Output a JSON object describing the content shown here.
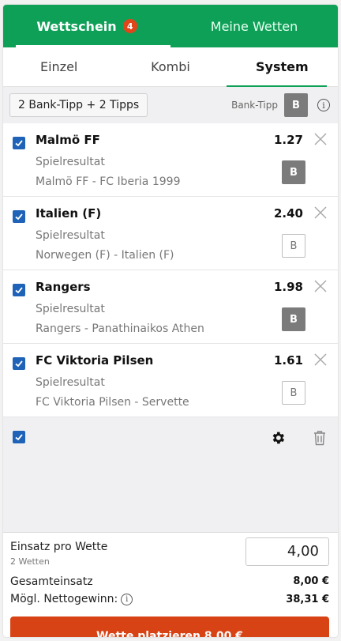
{
  "header": {
    "tabs": [
      {
        "label": "Wettschein",
        "badge": "4",
        "active": true
      },
      {
        "label": "Meine Wetten",
        "active": false
      }
    ]
  },
  "subtabs": [
    {
      "label": "Einzel",
      "active": false
    },
    {
      "label": "Kombi",
      "active": false
    },
    {
      "label": "System",
      "active": true
    }
  ],
  "system": {
    "selected": "2 Bank-Tipp + 2 Tipps",
    "bank_label": "Bank-Tipp",
    "bank_button": "B",
    "info_icon": "info-icon"
  },
  "bets": [
    {
      "name": "Malmö FF",
      "odds": "1.27",
      "type": "Spielresultat",
      "match": "Malmö FF - FC Iberia 1999",
      "bank": "B",
      "bank_selected": true,
      "checked": true
    },
    {
      "name": "Italien (F)",
      "odds": "2.40",
      "type": "Spielresultat",
      "match": "Norwegen (F) - Italien (F)",
      "bank": "B",
      "bank_selected": false,
      "checked": true
    },
    {
      "name": "Rangers",
      "odds": "1.98",
      "type": "Spielresultat",
      "match": "Rangers - Panathinaikos Athen",
      "bank": "B",
      "bank_selected": true,
      "checked": true
    },
    {
      "name": "FC Viktoria Pilsen",
      "odds": "1.61",
      "type": "Spielresultat",
      "match": "FC Viktoria Pilsen - Servette",
      "bank": "B",
      "bank_selected": false,
      "checked": true
    }
  ],
  "actions": {
    "select_all_checked": true,
    "settings_icon": "gear-icon",
    "delete_icon": "trash-icon"
  },
  "stake": {
    "label": "Einsatz pro Wette",
    "sub_label": "2 Wetten",
    "value": "4,00",
    "total_label": "Gesamteinsatz",
    "total_value": "8,00 €",
    "net_win_label": "Mögl. Nettogewinn:",
    "net_win_value": "38,31 €",
    "place_button": "Wette platzieren 8,00 €"
  },
  "colors": {
    "brand_green": "#0fa058",
    "badge_orange": "#e0461a",
    "checkbox_blue": "#1e63b8",
    "place_button": "#d84315",
    "bank_filled": "#7b7b7b"
  }
}
